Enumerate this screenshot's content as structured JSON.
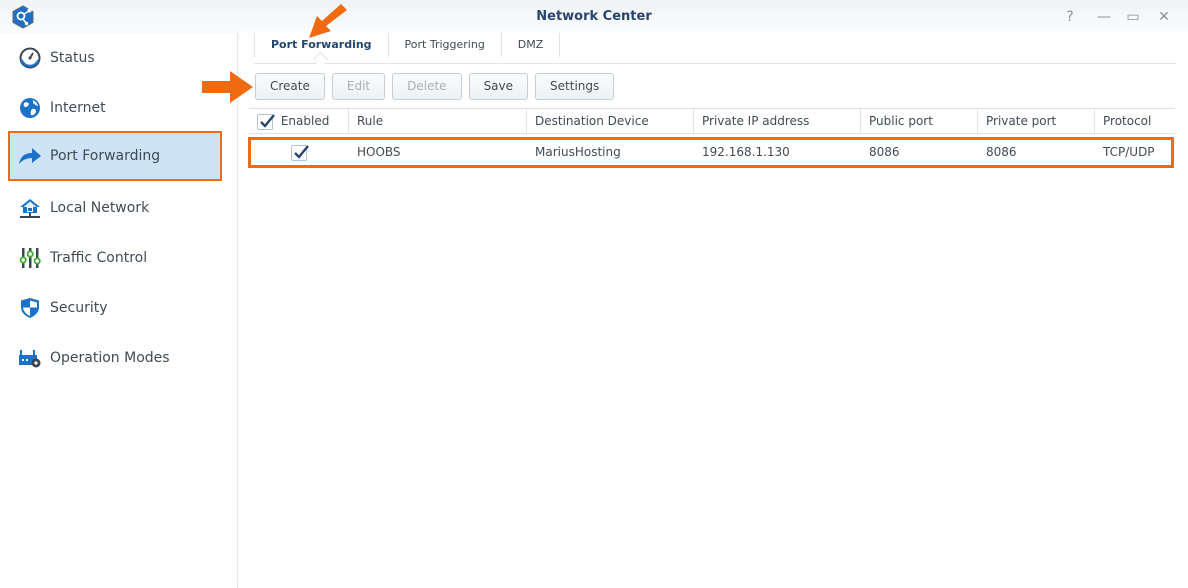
{
  "window": {
    "title": "Network Center",
    "controls": [
      "help",
      "minimize",
      "maximize",
      "close"
    ],
    "help_glyph": "?",
    "minimize_glyph": "—",
    "maximize_glyph": "▭",
    "close_glyph": "✕"
  },
  "sidebar": {
    "items": [
      {
        "label": "Status",
        "icon": "speedometer-icon"
      },
      {
        "label": "Internet",
        "icon": "globe-icon"
      },
      {
        "label": "Port Forwarding",
        "icon": "forward-arrow-icon",
        "active": true
      },
      {
        "label": "Local Network",
        "icon": "house-network-icon"
      },
      {
        "label": "Traffic Control",
        "icon": "sliders-icon"
      },
      {
        "label": "Security",
        "icon": "shield-icon"
      },
      {
        "label": "Operation Modes",
        "icon": "router-gear-icon"
      }
    ]
  },
  "tabs": [
    {
      "label": "Port Forwarding",
      "active": true
    },
    {
      "label": "Port Triggering"
    },
    {
      "label": "DMZ"
    }
  ],
  "toolbar": {
    "create": "Create",
    "edit": "Edit",
    "delete": "Delete",
    "save": "Save",
    "settings": "Settings"
  },
  "table": {
    "columns": [
      "Enabled",
      "Rule",
      "Destination Device",
      "Private IP address",
      "Public port",
      "Private port",
      "Protocol"
    ],
    "rows": [
      {
        "enabled": true,
        "rule": "HOOBS",
        "destination": "MariusHosting",
        "private_ip": "192.168.1.130",
        "public_port": "8086",
        "private_port": "8086",
        "protocol": "TCP/UDP"
      }
    ]
  },
  "colors": {
    "accent": "#f06a0f",
    "active_bg": "#cde3f6",
    "title": "#26466d",
    "icon_blue": "#1a73c9"
  }
}
